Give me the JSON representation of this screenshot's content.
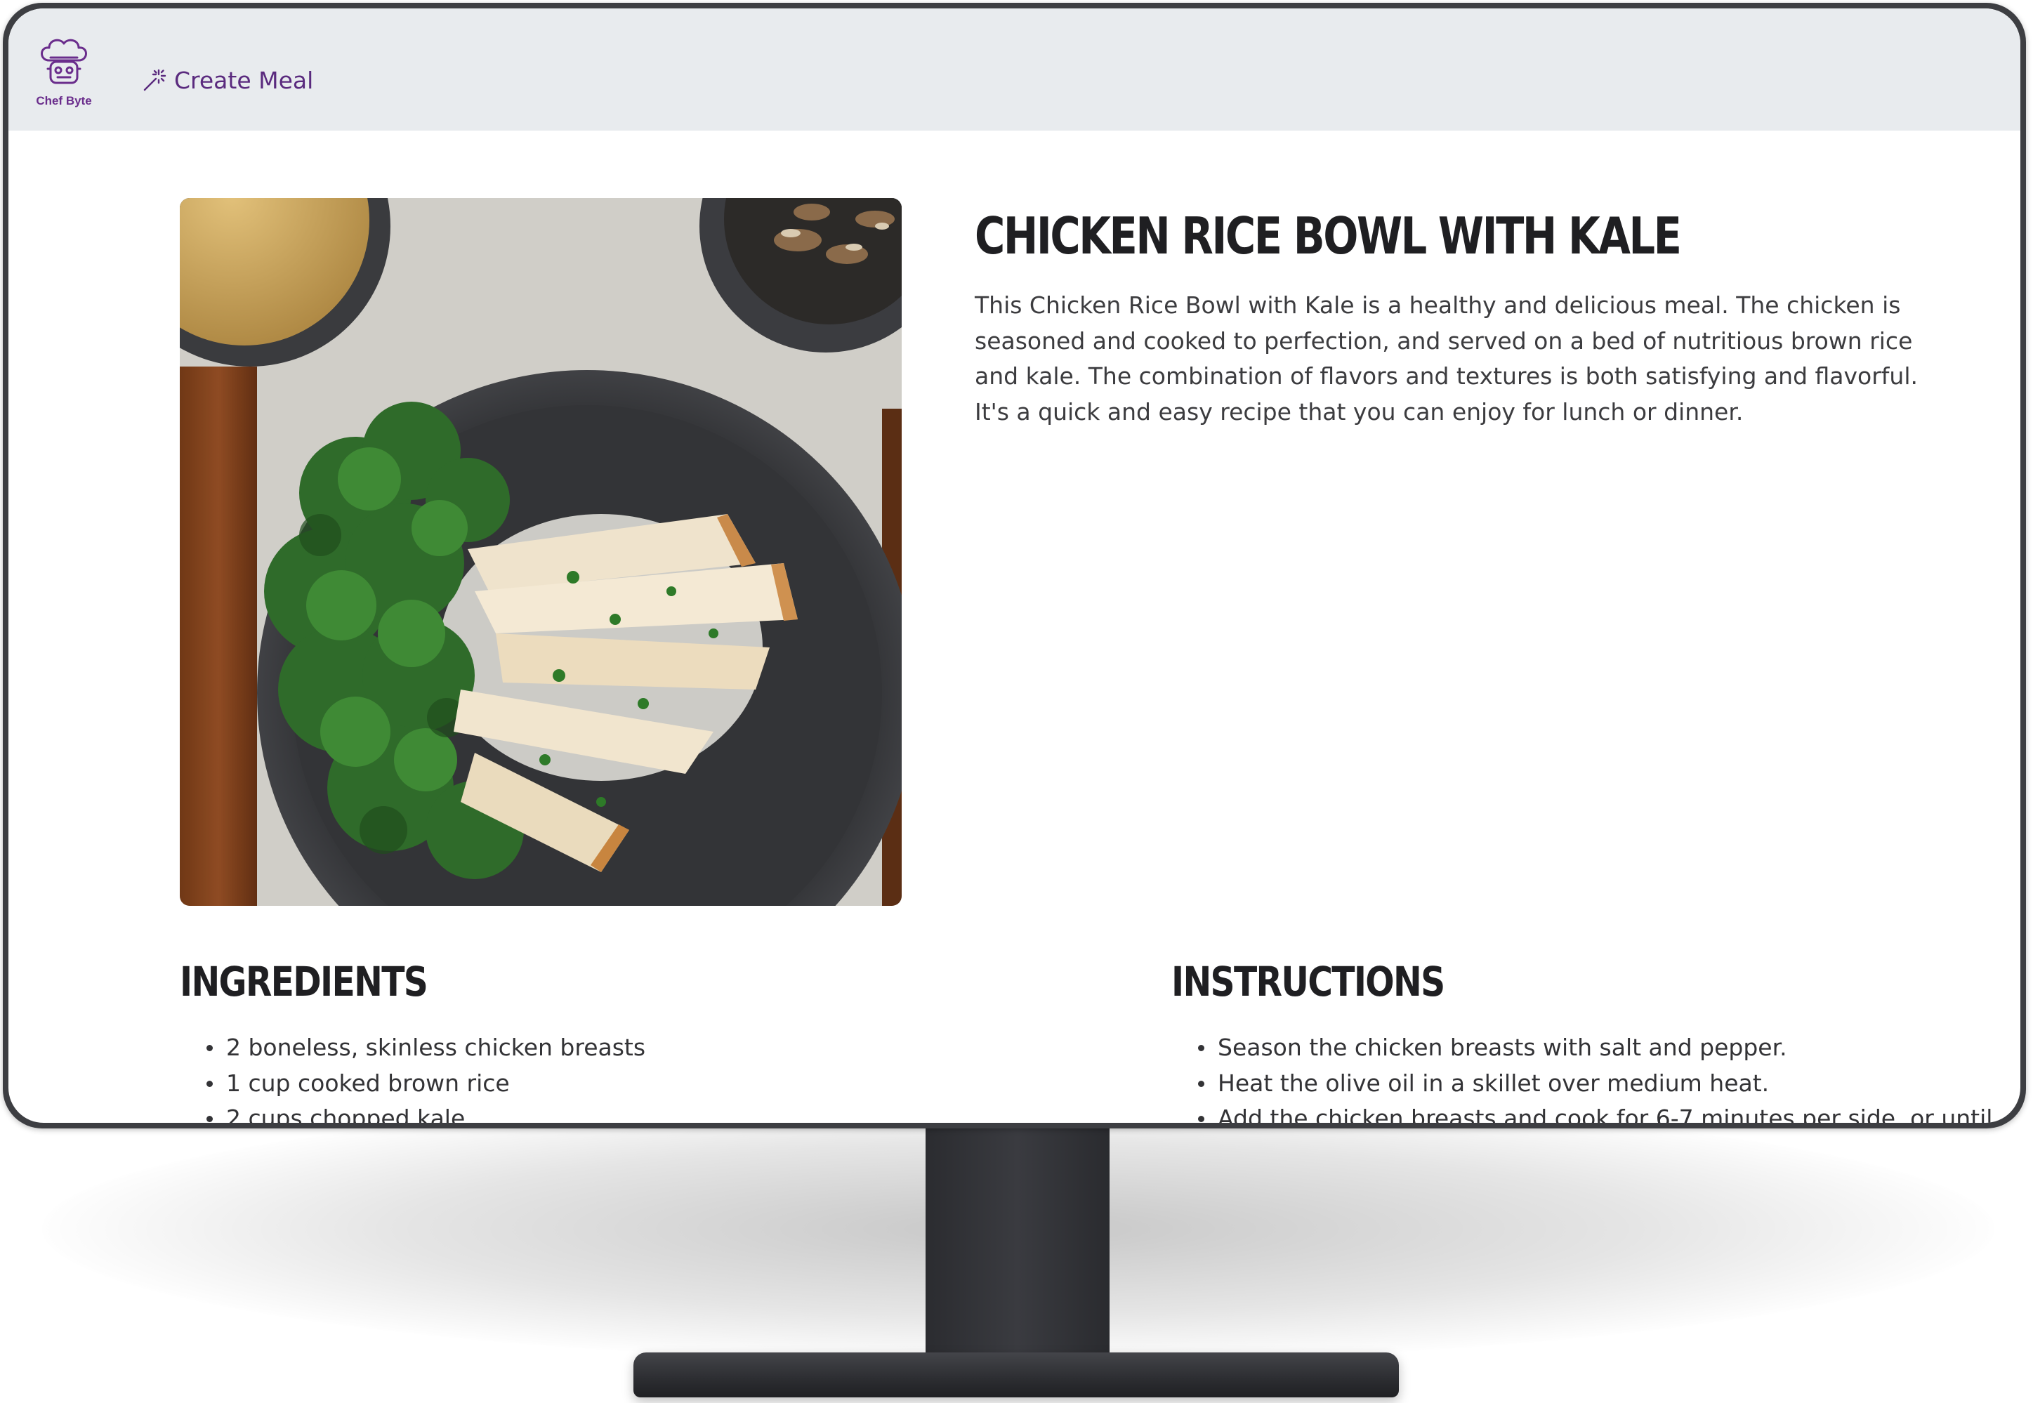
{
  "app": {
    "brand": "Chef Byte",
    "brand_color": "#6a2d8c",
    "header_bg": "#e8ebee"
  },
  "nav": {
    "create_meal": {
      "label": "Create Meal",
      "icon": "magic-wand-icon"
    }
  },
  "recipe": {
    "title": "Chicken Rice Bowl with Kale",
    "description": "This Chicken Rice Bowl with Kale is a healthy and delicious meal. The chicken is seasoned and cooked to perfection, and served on a bed of nutritious brown rice and kale. The combination of flavors and textures is both satisfying and flavorful. It's a quick and easy recipe that you can enjoy for lunch or dinner.",
    "image": "recipe-photo-chicken-rice-bowl"
  },
  "ingredients": {
    "heading": "INGREDIENTS",
    "items": [
      "2 boneless, skinless chicken breasts",
      "1 cup cooked brown rice",
      "2 cups chopped kale"
    ]
  },
  "instructions": {
    "heading": "INSTRUCTIONS",
    "items": [
      "Season the chicken breasts with salt and pepper.",
      "Heat the olive oil in a skillet over medium heat.",
      "Add the chicken breasts and cook for 6-7 minutes per side, or until"
    ]
  }
}
